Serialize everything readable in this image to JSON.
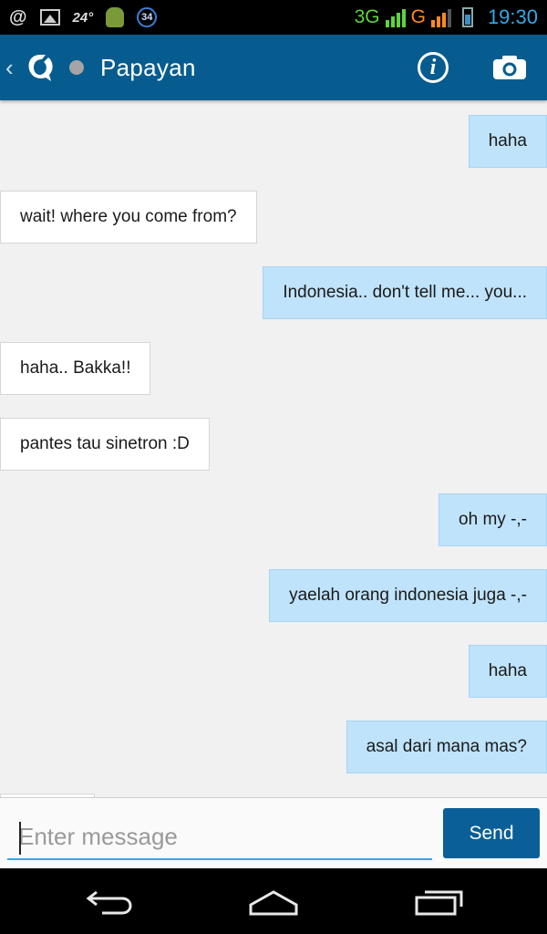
{
  "status_bar": {
    "temperature": "24°",
    "notification_count": "34",
    "network_1": "3G",
    "network_2": "G",
    "time": "19:30",
    "accent_time_color": "#33a8e8"
  },
  "header": {
    "contact_name": "Papayan",
    "presence": "offline",
    "icons": [
      "back-chevron-icon",
      "app-logo-icon",
      "info-icon",
      "camera-icon"
    ]
  },
  "messages": [
    {
      "side": "out",
      "text": "haha"
    },
    {
      "side": "in",
      "text": "wait! where you come from?"
    },
    {
      "side": "out",
      "text": "Indonesia.. don't tell me... you..."
    },
    {
      "side": "in",
      "text": "haha.. Bakka!!"
    },
    {
      "side": "in",
      "text": "pantes tau sinetron :D"
    },
    {
      "side": "out",
      "text": "oh my -,-"
    },
    {
      "side": "out",
      "text": "yaelah orang indonesia juga -,-"
    },
    {
      "side": "out",
      "text": "haha"
    },
    {
      "side": "out",
      "text": "asal dari mana mas?"
    }
  ],
  "composer": {
    "placeholder": "Enter message",
    "value": "",
    "send_label": "Send"
  },
  "colors": {
    "action_bar": "#065c8f",
    "outgoing_bubble": "#bfe3fa",
    "incoming_bubble": "#ffffff",
    "send_button": "#0a5f98"
  },
  "nav_bar": {
    "icons": [
      "back-icon",
      "home-icon",
      "recent-apps-icon"
    ]
  }
}
